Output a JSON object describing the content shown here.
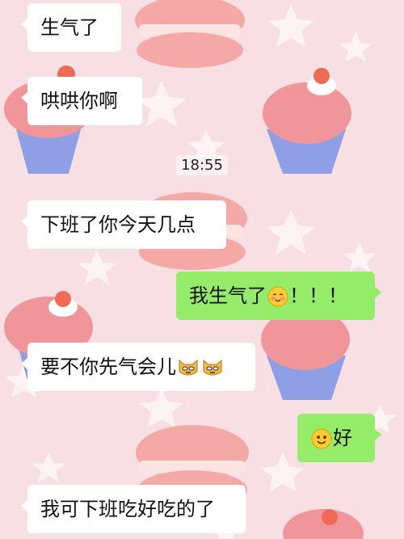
{
  "chat": {
    "messages": [
      {
        "side": "in",
        "text": "生气了"
      },
      {
        "side": "in",
        "text": "哄哄你啊"
      },
      {
        "side": "in",
        "text": "下班了你今天几点"
      },
      {
        "side": "out",
        "text_before": "我生气了",
        "emoji": "blush-face",
        "text_after": "！！！"
      },
      {
        "side": "in",
        "text": "要不你先气会儿",
        "emoji": "cat-face-pair"
      },
      {
        "side": "out",
        "emoji": "smile-face",
        "text_after": "好"
      },
      {
        "side": "in",
        "text": "我可下班吃好吃的了"
      }
    ],
    "timestamp": "18:55"
  },
  "colors": {
    "background": "#f8dfe3",
    "incoming_bubble": "#ffffff",
    "outgoing_bubble": "#95ec69"
  }
}
